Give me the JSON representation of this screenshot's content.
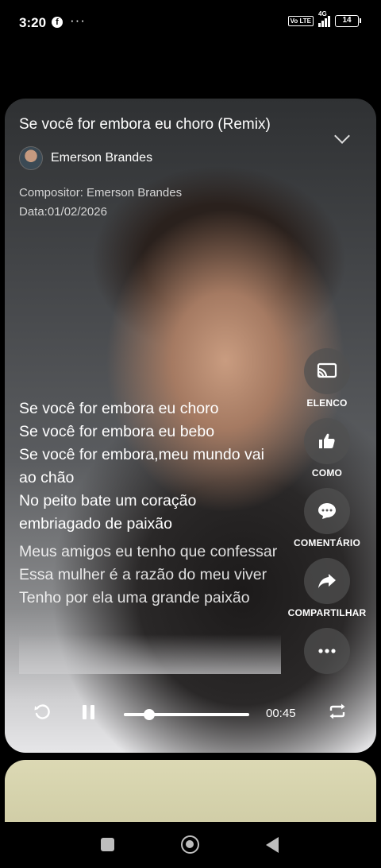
{
  "status_bar": {
    "time": "3:20",
    "facebook_icon": "f",
    "more": "···",
    "volte": "Vo LTE",
    "network": "4G",
    "battery": "14"
  },
  "song": {
    "title": "Se você for embora eu choro (Remix)",
    "artist": "Emerson Brandes",
    "composer": "Compositor: Emerson Brandes",
    "date": "Data:01/02/2026"
  },
  "lyrics": [
    "Se você for embora eu choro",
    "Se você for embora eu bebo",
    "Se você for embora,meu mundo vai ao chão",
    "No peito bate um coração embriagado de paixão",
    "Meus amigos eu tenho que confessar",
    "Essa mulher é a razão do meu viver",
    "Tenho por ela uma grande paixão"
  ],
  "actions": {
    "cast": {
      "label": "ELENCO",
      "icon": "cast-icon"
    },
    "like": {
      "label": "COMO",
      "icon": "thumbs-up-icon"
    },
    "comment": {
      "label": "COMENTÁRIO",
      "icon": "comment-icon"
    },
    "share": {
      "label": "COMPARTILHAR",
      "icon": "share-icon"
    },
    "more": {
      "icon": "more-icon"
    }
  },
  "player": {
    "time": "00:45",
    "progress": 0.2,
    "state": "playing"
  }
}
